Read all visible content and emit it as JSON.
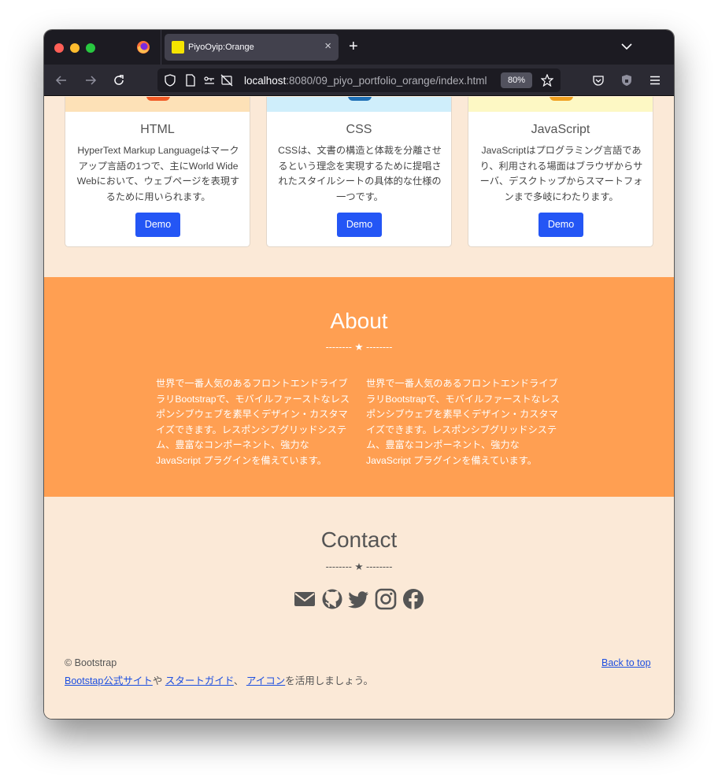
{
  "browser": {
    "tab_title": "PiyoOyip:Orange",
    "url_host": "localhost",
    "url_path": ":8080/09_piyo_portfolio_orange/index.html",
    "zoom": "80%",
    "new_tab_symbol": "+",
    "close_symbol": "×"
  },
  "cards": [
    {
      "title": "HTML",
      "text": "HyperText Markup Languageはマークアップ言語の1つで、主にWorld Wide Webにおいて、ウェブページを表現するために用いられます。",
      "button": "Demo",
      "image_color": "#fde1b7",
      "shape_color": "#f05a25"
    },
    {
      "title": "CSS",
      "text": "CSSは、文書の構造と体裁を分離させるという理念を実現するために提唱されたスタイルシートの具体的な仕様の一つです。",
      "button": "Demo",
      "image_color": "#cfeefb",
      "shape_color": "#1f6fb5"
    },
    {
      "title": "JavaScript",
      "text": "JavaScriptはプログラミング言語であり、利用される場面はブラウザからサーバ、デスクトップからスマートフォンまで多岐にわたります。",
      "button": "Demo",
      "image_color": "#fdf8c4",
      "shape_color": "#f0a020"
    }
  ],
  "about": {
    "heading": "About",
    "divider": "-------- ★ --------",
    "left_text": "世界で一番人気のあるフロントエンドライブラリBootstrapで、モバイルファーストなレスポンシブウェブを素早くデザイン・カスタマイズできます。レスポンシブグリッドシステム、豊富なコンポーネント、強力な JavaScript プラグインを備えています。",
    "right_text": "世界で一番人気のあるフロントエンドライブラリBootstrapで、モバイルファーストなレスポンシブウェブを素早くデザイン・カスタマイズできます。レスポンシブグリッドシステム、豊富なコンポーネント、強力な JavaScript プラグインを備えています。",
    "background": "#ff9f52"
  },
  "contact": {
    "heading": "Contact",
    "divider": "-------- ★ --------",
    "icons": [
      "envelope-icon",
      "github-icon",
      "twitter-icon",
      "instagram-icon",
      "facebook-icon"
    ]
  },
  "footer": {
    "copyright": "© Bootstrap",
    "back_to_top": "Back to top",
    "link1": "Bootstap公式サイト",
    "sep1": "や",
    "link2": "スタートガイド",
    "sep2": "、",
    "link3": "アイコン",
    "tail": "を活用しましょう。"
  },
  "colors": {
    "page_bg": "#fbe9d7",
    "button_blue": "#2456f5",
    "link_blue": "#1d4fe0"
  }
}
